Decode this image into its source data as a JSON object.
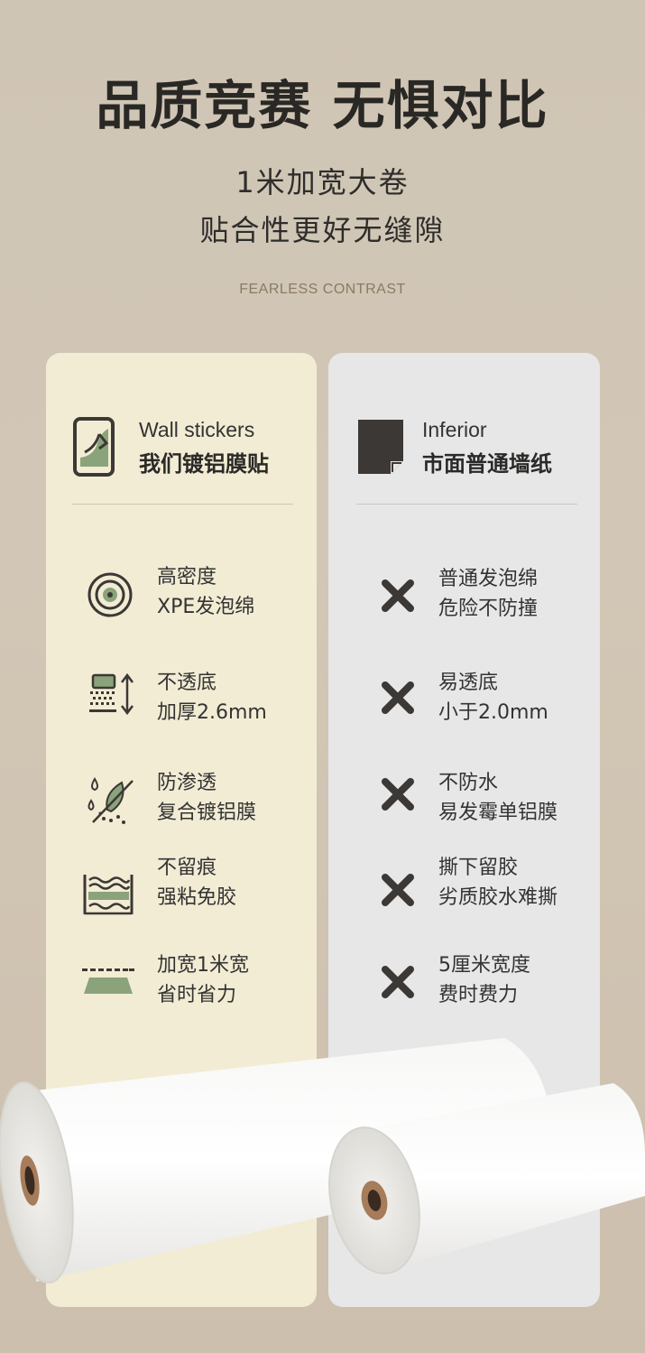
{
  "header": {
    "title": "品质竞赛 无惧对比",
    "subtitle_line1": "1米加宽大卷",
    "subtitle_line2": "贴合性更好无缝隙",
    "tagline": "FEARLESS CONTRAST"
  },
  "left_panel": {
    "title_en": "Wall stickers",
    "title_cn": "我们镀铝膜贴",
    "features": [
      {
        "icon": "target-icon",
        "line1": "高密度",
        "line2": "XPE发泡绵"
      },
      {
        "icon": "thickness-icon",
        "line1": "不透底",
        "line2": "加厚2.6mm"
      },
      {
        "icon": "leaf-drop-icon",
        "line1": "防渗透",
        "line2": "复合镀铝膜"
      },
      {
        "icon": "wave-layers-icon",
        "line1": "不留痕",
        "line2": "强粘免胶"
      },
      {
        "icon": "width-icon",
        "line1": "加宽1米宽",
        "line2": "省时省力"
      }
    ]
  },
  "right_panel": {
    "title_en": "Inferior",
    "title_cn": "市面普通墙纸",
    "features": [
      {
        "icon": "cross-icon",
        "line1": "普通发泡绵",
        "line2": "危险不防撞"
      },
      {
        "icon": "cross-icon",
        "line1": "易透底",
        "line2": "小于2.0mm"
      },
      {
        "icon": "cross-icon",
        "line1": "不防水",
        "line2": "易发霉单铝膜"
      },
      {
        "icon": "cross-icon",
        "line1": "撕下留胶",
        "line2": "劣质胶水难撕"
      },
      {
        "icon": "cross-icon",
        "line1": "5厘米宽度",
        "line2": "费时费力"
      }
    ]
  },
  "colors": {
    "background": "#d0c6b5",
    "left_panel": "#f2ecd4",
    "right_panel": "#e7e7e7",
    "accent_green": "#8aa37a",
    "icon_dark": "#3b3835"
  }
}
